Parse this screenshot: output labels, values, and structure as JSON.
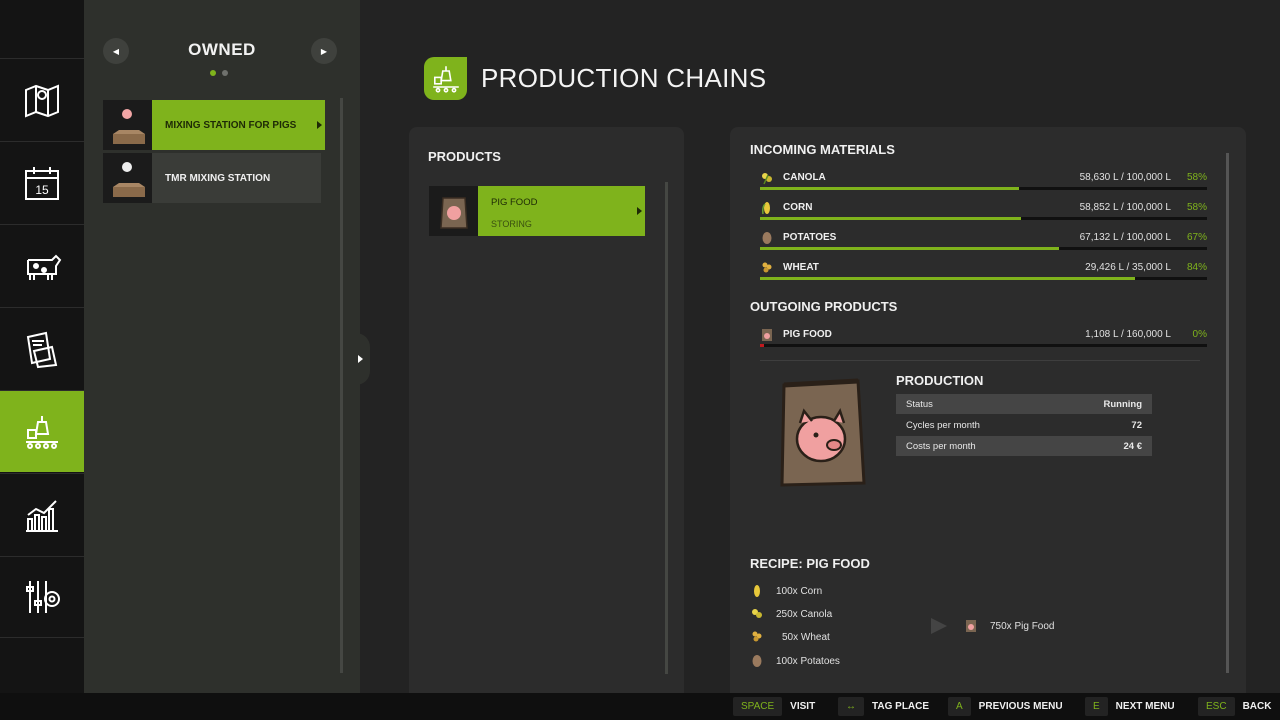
{
  "rail": {
    "items": [
      {
        "icon": "map-icon"
      },
      {
        "icon": "calendar-icon",
        "day": "15"
      },
      {
        "icon": "cow-icon"
      },
      {
        "icon": "contracts-icon"
      },
      {
        "icon": "production-icon",
        "active": true
      },
      {
        "icon": "statistics-icon"
      },
      {
        "icon": "settings-icon"
      }
    ]
  },
  "owned": {
    "title": "OWNED",
    "stations": [
      {
        "label": "MIXING STATION FOR PIGS",
        "selected": true
      },
      {
        "label": "TMR MIXING STATION",
        "selected": false
      }
    ]
  },
  "header": {
    "title": "PRODUCTION CHAINS"
  },
  "products": {
    "heading": "PRODUCTS",
    "items": [
      {
        "name": "PIG FOOD",
        "status": "STORING"
      }
    ]
  },
  "details": {
    "incoming_heading": "INCOMING MATERIALS",
    "incoming": [
      {
        "name": "CANOLA",
        "amount": "58,630 L / 100,000 L",
        "percent": "58%",
        "fill": 0.58
      },
      {
        "name": "CORN",
        "amount": "58,852 L / 100,000 L",
        "percent": "58%",
        "fill": 0.585
      },
      {
        "name": "POTATOES",
        "amount": "67,132 L / 100,000 L",
        "percent": "67%",
        "fill": 0.67
      },
      {
        "name": "WHEAT",
        "amount": "29,426 L / 35,000 L",
        "percent": "84%",
        "fill": 0.84
      }
    ],
    "outgoing_heading": "OUTGOING PRODUCTS",
    "outgoing": [
      {
        "name": "PIG FOOD",
        "amount": "1,108 L / 160,000 L",
        "percent": "0%",
        "fill": 0.01
      }
    ],
    "production_heading": "PRODUCTION",
    "production": {
      "status_label": "Status",
      "status_value": "Running",
      "cycles_label": "Cycles per month",
      "cycles_value": "72",
      "costs_label": "Costs per month",
      "costs_value": "24 €"
    },
    "recipe_heading": "RECIPE: PIG FOOD",
    "recipe_inputs": [
      "100x Corn",
      "250x Canola",
      "50x Wheat",
      "100x Potatoes"
    ],
    "recipe_output": "750x Pig Food"
  },
  "bottom_bar": [
    {
      "key": "SPACE",
      "label": "VISIT"
    },
    {
      "key": "↔",
      "label": "TAG PLACE"
    },
    {
      "key": "A",
      "label": "PREVIOUS MENU"
    },
    {
      "key": "E",
      "label": "NEXT MENU"
    },
    {
      "key": "ESC",
      "label": "BACK"
    }
  ],
  "colors": {
    "accent": "#7fb31c",
    "panel": "#2c2c2c",
    "danger": "#c0191e"
  }
}
